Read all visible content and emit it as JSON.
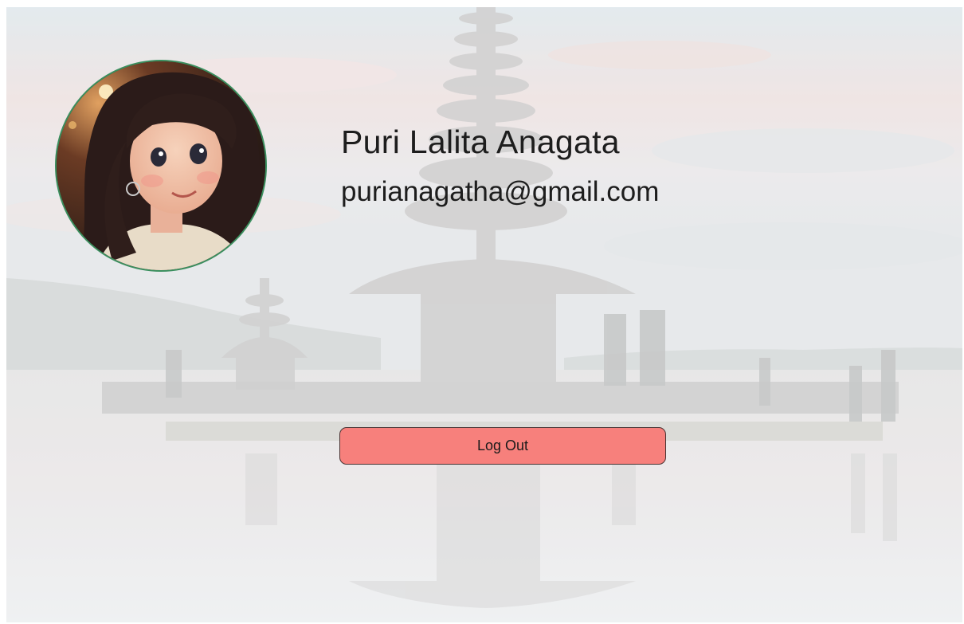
{
  "profile": {
    "name": "Puri Lalita Anagata",
    "email": "purianagatha@gmail.com",
    "avatar_icon": "user-avatar"
  },
  "actions": {
    "logout_label": "Log Out"
  },
  "colors": {
    "logout_bg": "#f7807c",
    "avatar_border": "#3a8f5e",
    "text": "#1d1d1d"
  }
}
